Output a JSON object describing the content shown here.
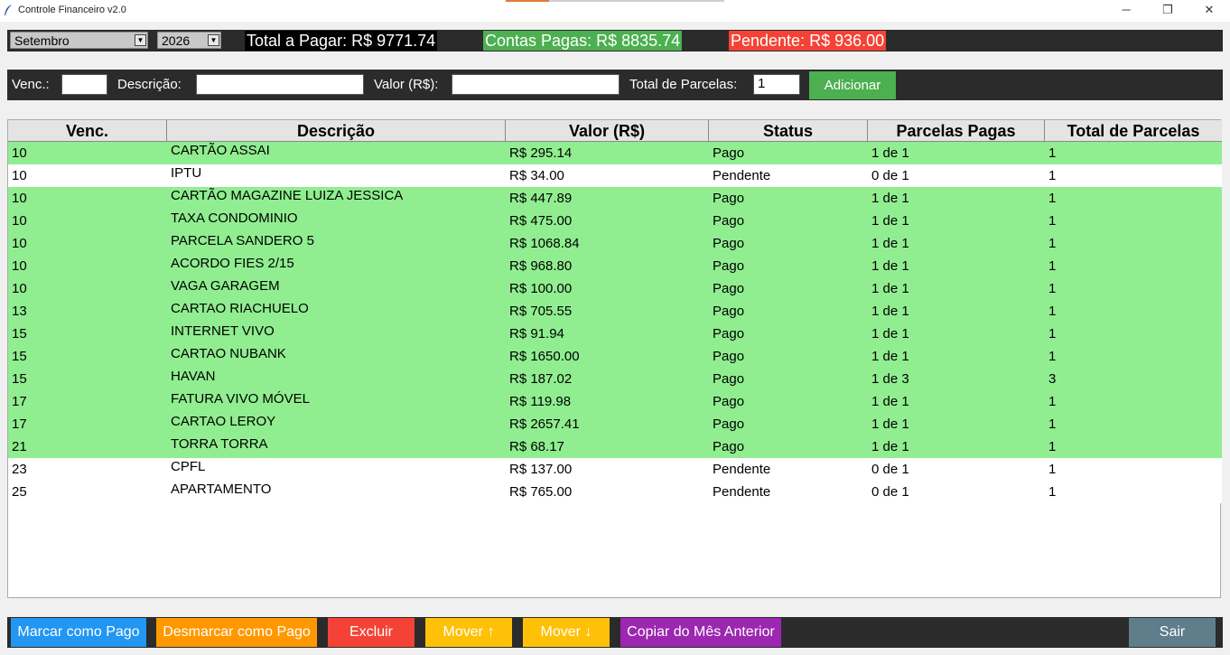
{
  "window": {
    "title": "Controle Financeiro v2.0",
    "minimize": "─",
    "maximize": "❐",
    "close": "✕"
  },
  "top": {
    "month": "Setembro",
    "year": "2026",
    "total_a_pagar": "Total a Pagar: R$ 9771.74",
    "contas_pagas": "Contas Pagas: R$ 8835.74",
    "pendente": "Pendente: R$ 936.00"
  },
  "form": {
    "venc_label": "Venc.:",
    "venc_value": "",
    "descricao_label": "Descrição:",
    "descricao_value": "",
    "valor_label": "Valor (R$):",
    "valor_value": "",
    "parcelas_label": "Total de Parcelas:",
    "parcelas_value": "1",
    "add_button": "Adicionar"
  },
  "table": {
    "columns": [
      "Venc.",
      "Descrição",
      "Valor (R$)",
      "Status",
      "Parcelas Pagas",
      "Total de Parcelas"
    ],
    "rows": [
      {
        "venc": "10",
        "desc": "CARTÃO ASSAI",
        "valor": "R$ 295.14",
        "status": "Pago",
        "pagas": "1 de 1",
        "total": "1"
      },
      {
        "venc": "10",
        "desc": "IPTU",
        "valor": "R$ 34.00",
        "status": "Pendente",
        "pagas": "0 de 1",
        "total": "1"
      },
      {
        "venc": "10",
        "desc": "CARTÃO MAGAZINE LUIZA JESSICA",
        "valor": "R$ 447.89",
        "status": "Pago",
        "pagas": "1 de 1",
        "total": "1"
      },
      {
        "venc": "10",
        "desc": "TAXA CONDOMINIO",
        "valor": "R$ 475.00",
        "status": "Pago",
        "pagas": "1 de 1",
        "total": "1"
      },
      {
        "venc": "10",
        "desc": "PARCELA SANDERO 5",
        "valor": "R$ 1068.84",
        "status": "Pago",
        "pagas": "1 de 1",
        "total": "1"
      },
      {
        "venc": "10",
        "desc": "ACORDO FIES 2/15",
        "valor": "R$ 968.80",
        "status": "Pago",
        "pagas": "1 de 1",
        "total": "1"
      },
      {
        "venc": "10",
        "desc": "VAGA GARAGEM",
        "valor": "R$ 100.00",
        "status": "Pago",
        "pagas": "1 de 1",
        "total": "1"
      },
      {
        "venc": "13",
        "desc": "CARTAO RIACHUELO",
        "valor": "R$ 705.55",
        "status": "Pago",
        "pagas": "1 de 1",
        "total": "1"
      },
      {
        "venc": "15",
        "desc": "INTERNET VIVO",
        "valor": "R$ 91.94",
        "status": "Pago",
        "pagas": "1 de 1",
        "total": "1"
      },
      {
        "venc": "15",
        "desc": "CARTAO NUBANK",
        "valor": "R$ 1650.00",
        "status": "Pago",
        "pagas": "1 de 1",
        "total": "1"
      },
      {
        "venc": "15",
        "desc": "HAVAN",
        "valor": "R$ 187.02",
        "status": "Pago",
        "pagas": "1 de 3",
        "total": "3"
      },
      {
        "venc": "17",
        "desc": "FATURA VIVO MÓVEL",
        "valor": "R$ 119.98",
        "status": "Pago",
        "pagas": "1 de 1",
        "total": "1"
      },
      {
        "venc": "17",
        "desc": "CARTAO LEROY",
        "valor": "R$ 2657.41",
        "status": "Pago",
        "pagas": "1 de 1",
        "total": "1"
      },
      {
        "venc": "21",
        "desc": "TORRA TORRA",
        "valor": "R$ 68.17",
        "status": "Pago",
        "pagas": "1 de 1",
        "total": "1"
      },
      {
        "venc": "23",
        "desc": "CPFL",
        "valor": "R$ 137.00",
        "status": "Pendente",
        "pagas": "0 de 1",
        "total": "1"
      },
      {
        "venc": "25",
        "desc": "APARTAMENTO",
        "valor": "R$ 765.00",
        "status": "Pendente",
        "pagas": "0 de 1",
        "total": "1"
      }
    ]
  },
  "actions": {
    "marcar_pago": "Marcar como Pago",
    "desmarcar_pago": "Desmarcar como Pago",
    "excluir": "Excluir",
    "mover_cima": "Mover ↑",
    "mover_baixo": "Mover ↓",
    "copiar": "Copiar do Mês Anterior",
    "sair": "Sair"
  },
  "colors": {
    "pago_row": "#90ee90",
    "pendente_row": "#ffffff",
    "green": "#4caf50",
    "red": "#f44336",
    "blue": "#2196f3",
    "orange": "#ff9800",
    "amber": "#ffc107",
    "purple": "#9c27b0",
    "slate": "#607d8b",
    "dark": "#2b2b2b"
  },
  "icons": {
    "app": "feather-icon",
    "dropdown": "chevron-down-icon"
  }
}
